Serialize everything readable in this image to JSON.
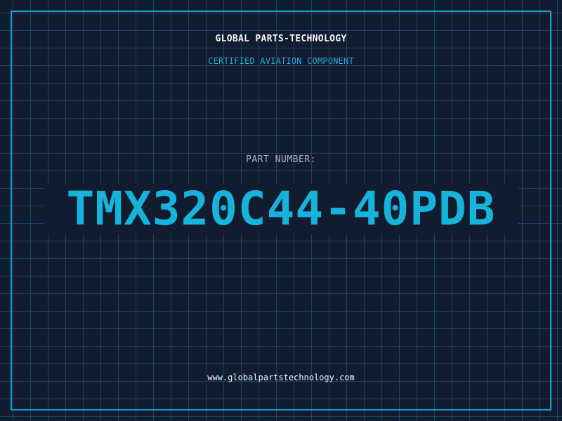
{
  "header": {
    "company": "GLOBAL PARTS-TECHNOLOGY",
    "tagline": "CERTIFIED AVIATION COMPONENT"
  },
  "part": {
    "label": "PART NUMBER:",
    "number": "TMX320C44-40PDB"
  },
  "footer": {
    "website": "www.globalpartstechnology.com"
  },
  "colors": {
    "background": "#111c30",
    "grid": "#1a6482",
    "frame": "#1b9ec7",
    "accent": "#15b4dc",
    "white_text": "#f2f4f7",
    "muted_text": "#a7b2c3"
  }
}
